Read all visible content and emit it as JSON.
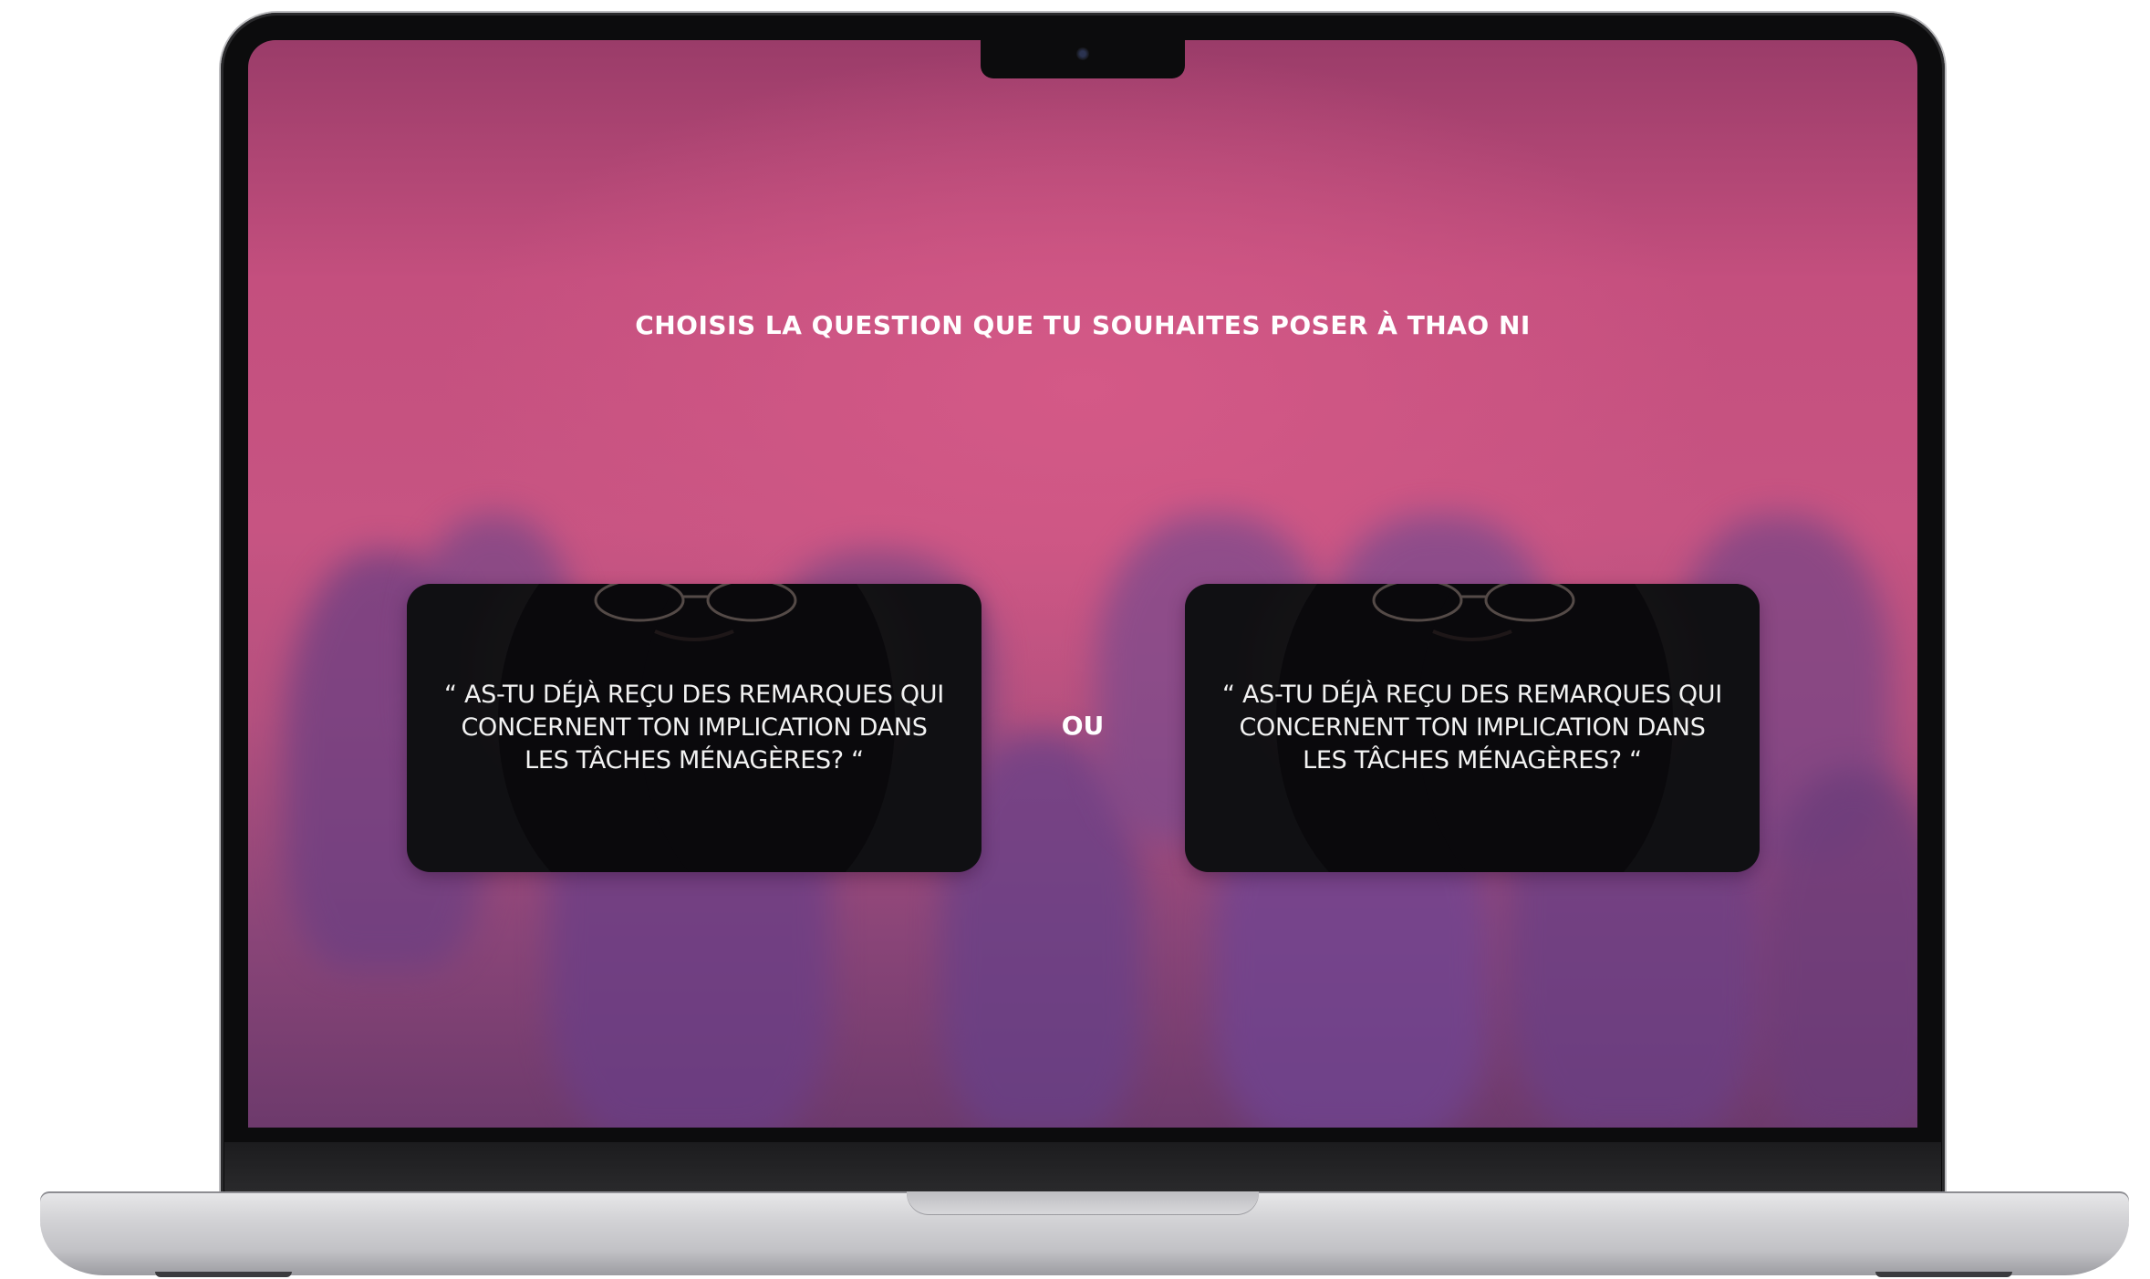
{
  "screen": {
    "prompt_title": "CHOISIS LA QUESTION QUE TU SOUHAITES POSER À THAO NI",
    "separator_label": "OU",
    "cards": [
      {
        "question": "“ AS-TU DÉJÀ REÇU DES REMARQUES QUI CONCERNENT TON IMPLICATION DANS LES TÂCHES MÉNAGÈRES? “"
      },
      {
        "question": "“ AS-TU DÉJÀ REÇU DES REMARQUES QUI CONCERNENT TON IMPLICATION DANS LES TÂCHES MÉNAGÈRES? “"
      }
    ]
  },
  "colors": {
    "background_pink": "#c75482",
    "background_purple": "#6d3a6c",
    "card_dark": "#121114",
    "text_white": "#ffffff"
  }
}
